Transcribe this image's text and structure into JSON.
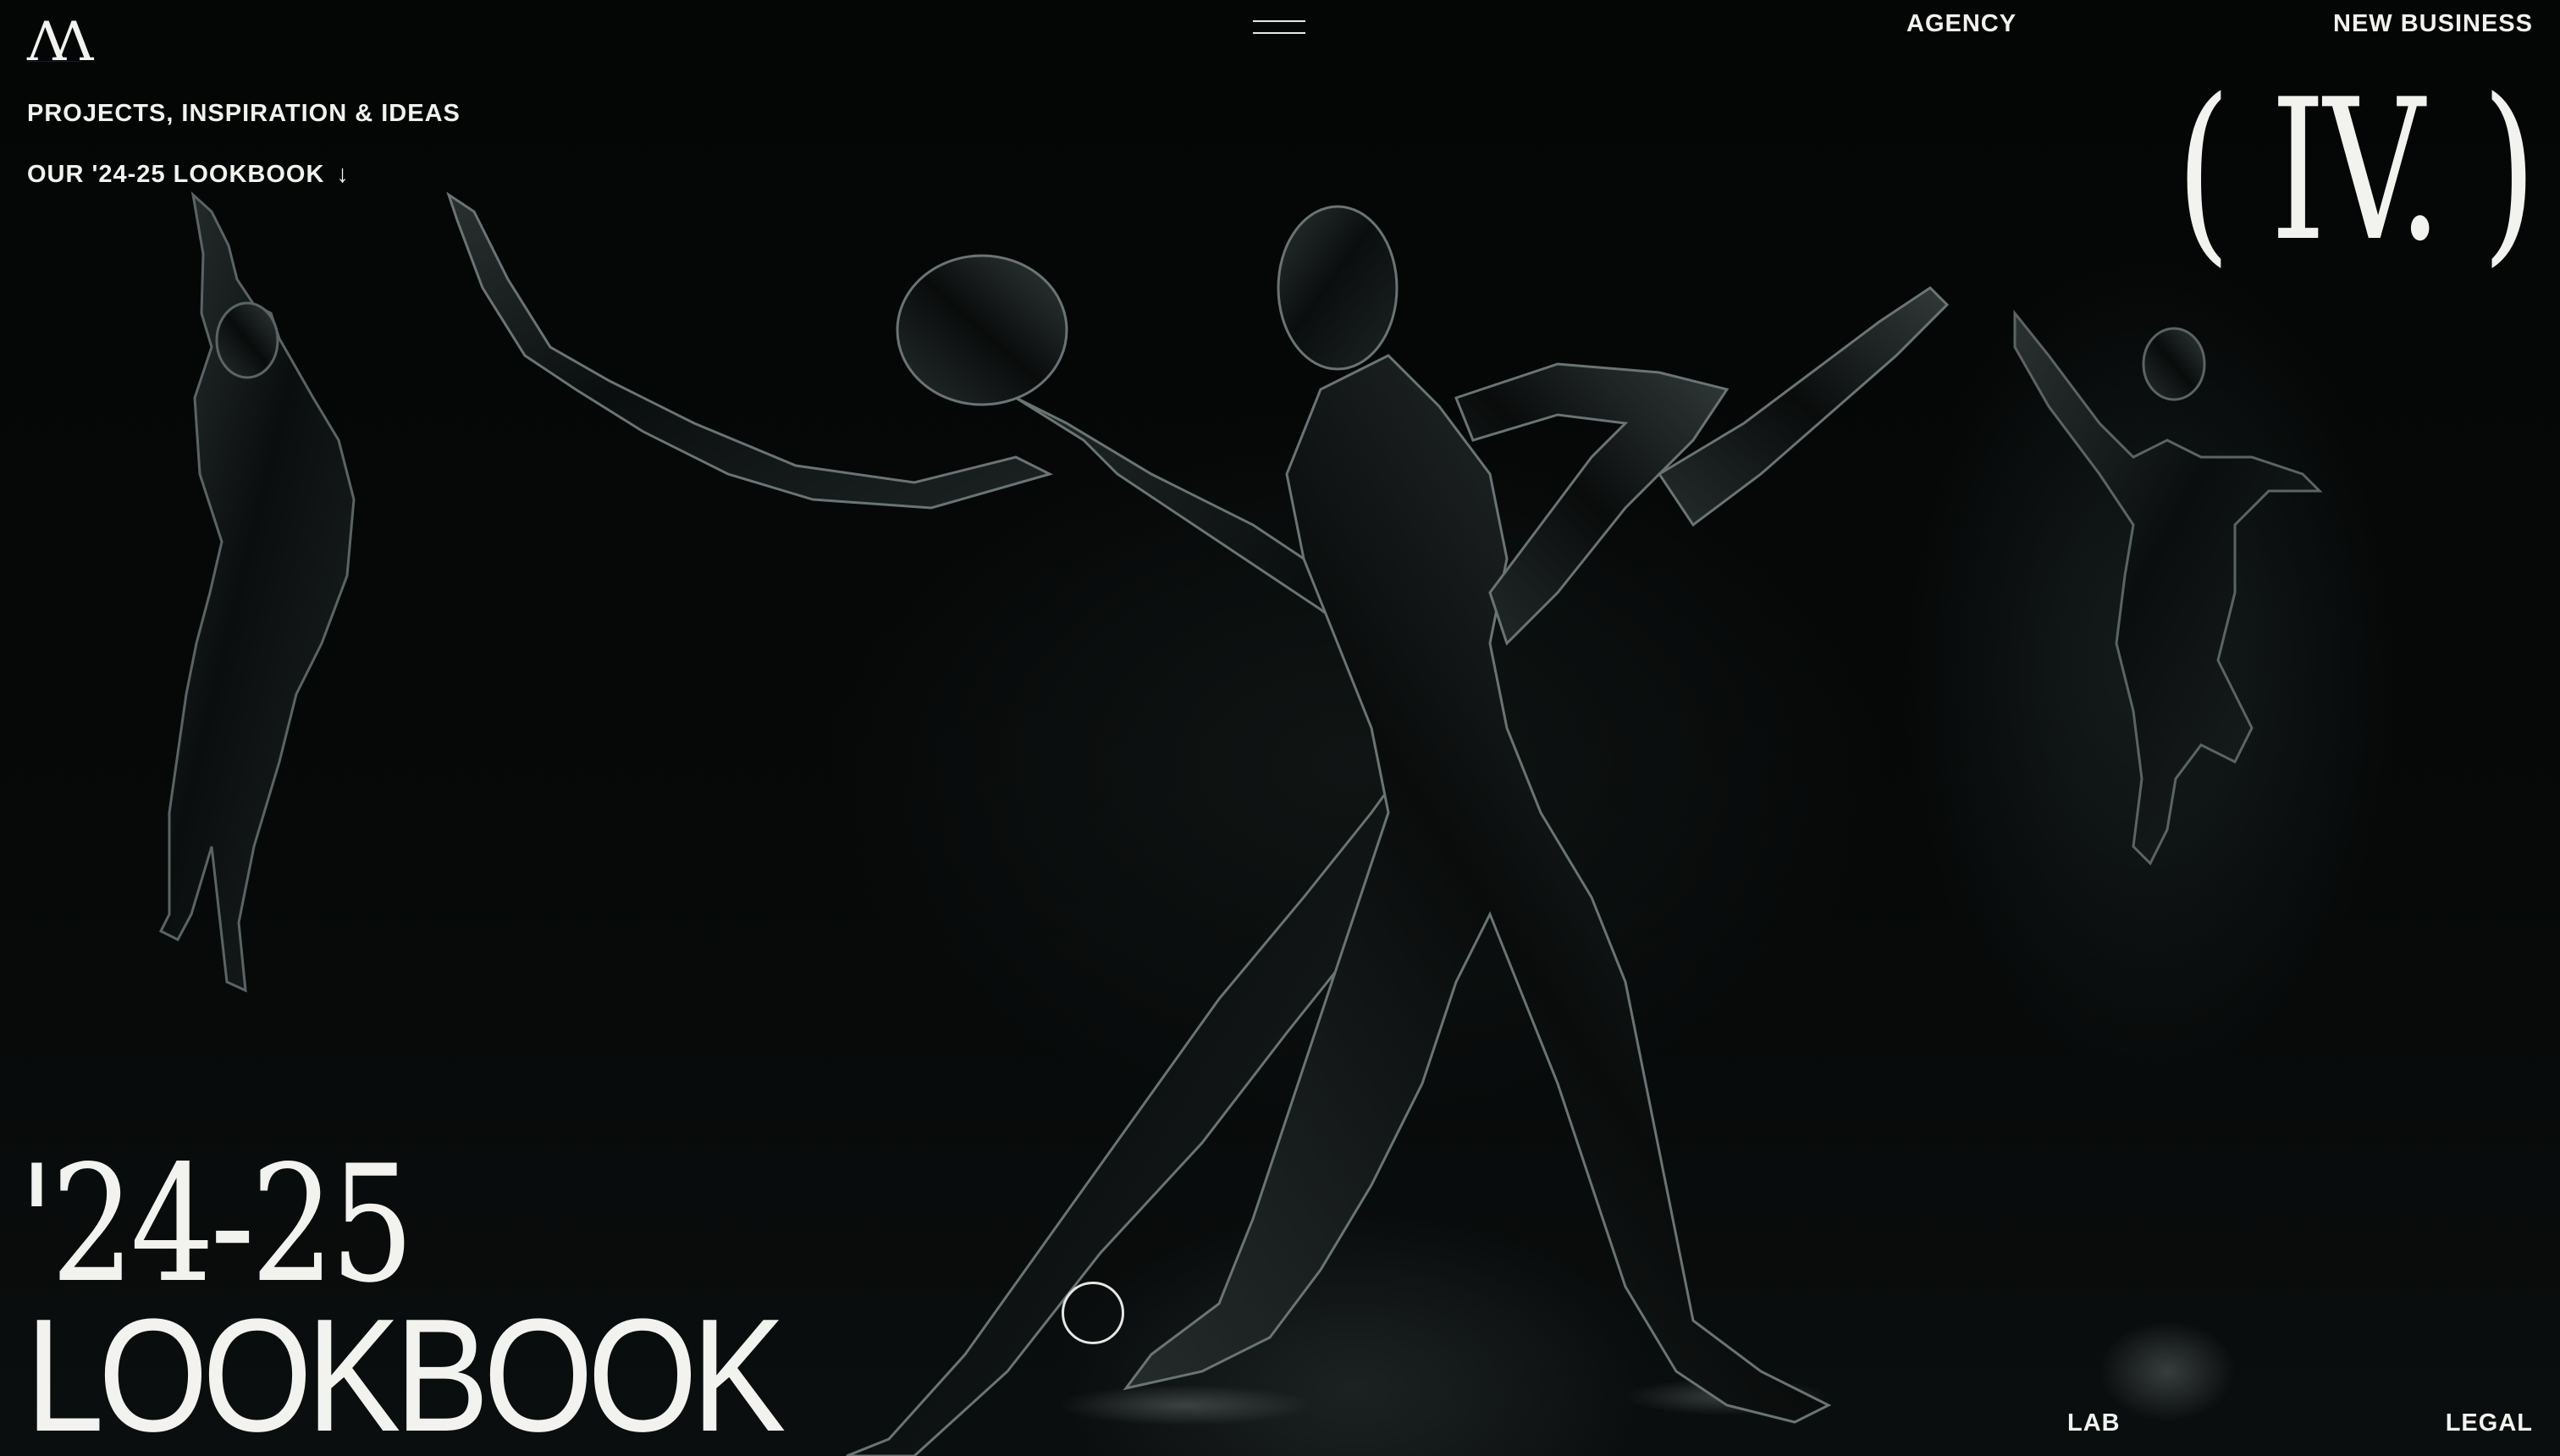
{
  "header": {
    "logo_text": "M",
    "menu_icon": "hamburger-icon",
    "nav": {
      "agency": "AGENCY",
      "new_business": "NEW BUSINESS"
    }
  },
  "intro": {
    "projects_link": "PROJECTS, INSPIRATION & IDEAS",
    "lookbook_link": "OUR '24-25 LOOKBOOK",
    "lookbook_arrow": "↓"
  },
  "chapter": "( IV. )",
  "hero": {
    "year": "'24-25",
    "title": "LOOKBOOK"
  },
  "footer": {
    "lab": "LAB",
    "legal": "LEGAL"
  },
  "colors": {
    "background": "#050606",
    "text": "#f2f2ee"
  }
}
